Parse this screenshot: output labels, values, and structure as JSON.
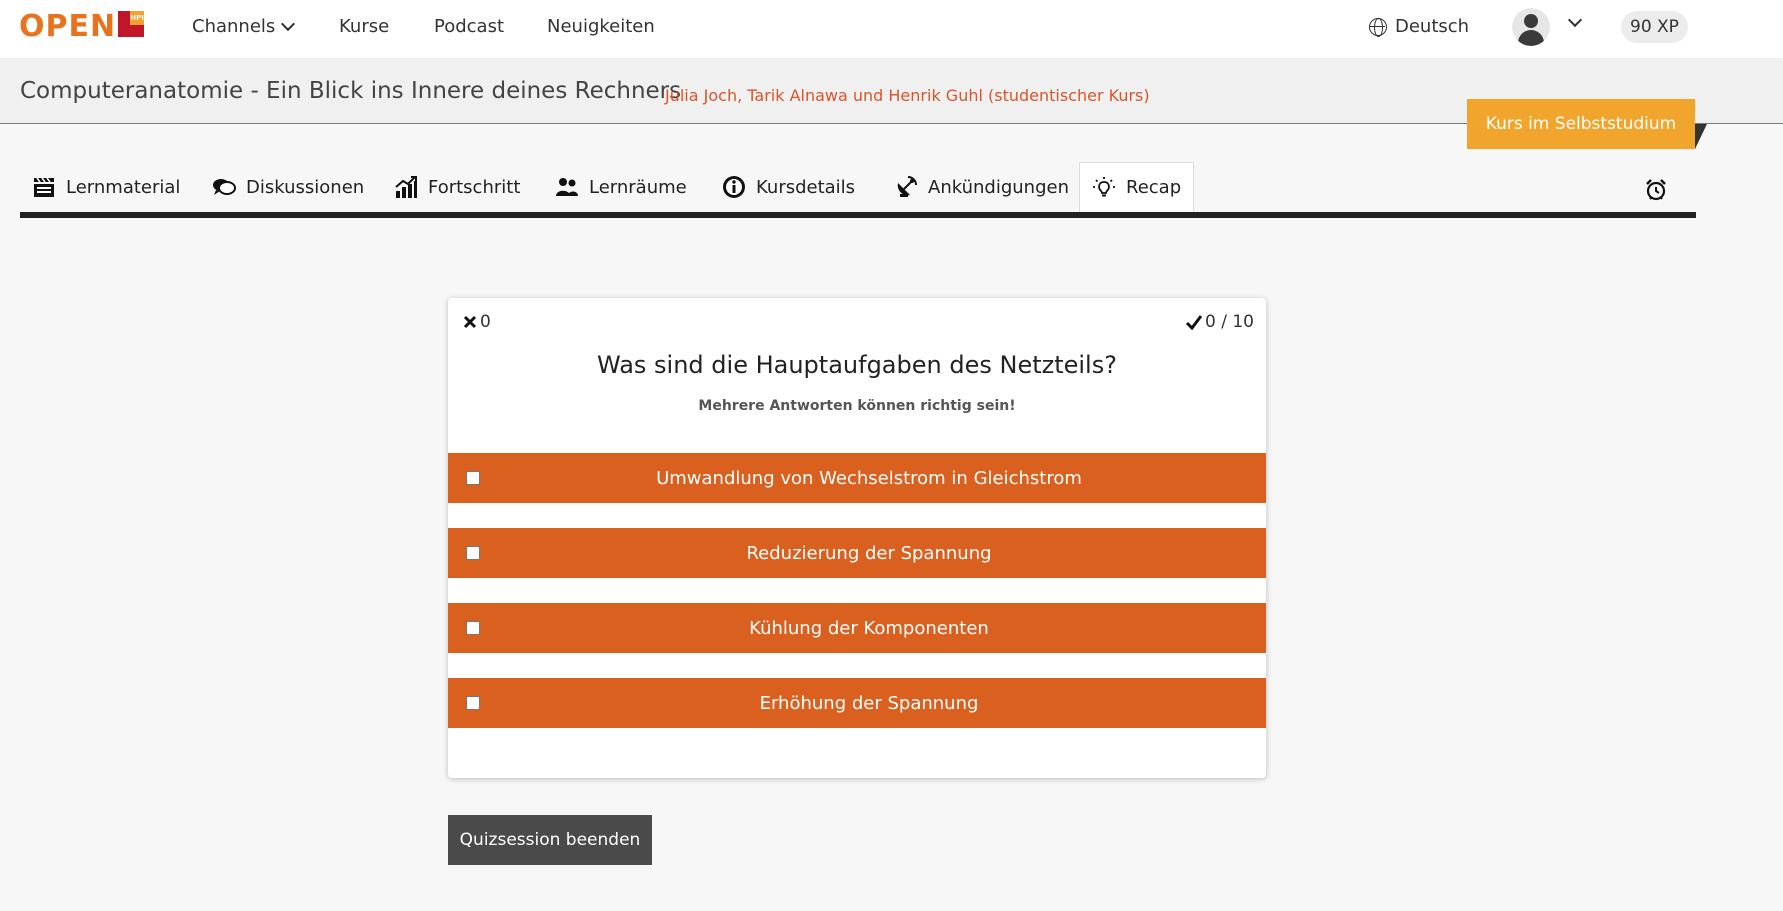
{
  "header": {
    "logo_text": "OPEN",
    "logo_badge": "HPI",
    "nav": {
      "channels": "Channels",
      "kurse": "Kurse",
      "podcast": "Podcast",
      "neuigkeiten": "Neuigkeiten"
    },
    "language": "Deutsch",
    "xp": "90 XP"
  },
  "course": {
    "title": "Computeranatomie - Ein Blick ins Innere deines Rechners",
    "authors": "Julia Joch, Tarik Alnawa und Henrik Guhl (studentischer Kurs)",
    "self_study_label": "Kurs im Selbststudium"
  },
  "tabs": [
    {
      "label": "Lernmaterial",
      "icon": "clapperboard-icon"
    },
    {
      "label": "Diskussionen",
      "icon": "speech-bubbles-icon"
    },
    {
      "label": "Fortschritt",
      "icon": "chart-icon"
    },
    {
      "label": "Lernräume",
      "icon": "people-icon"
    },
    {
      "label": "Kursdetails",
      "icon": "info-icon"
    },
    {
      "label": "Ankündigungen",
      "icon": "satellite-dish-icon"
    },
    {
      "label": "Recap",
      "icon": "lightbulb-icon",
      "active": true
    }
  ],
  "quiz": {
    "wrong_count": "0",
    "right_progress": "0 / 10",
    "question": "Was sind die Hauptaufgaben des Netzteils?",
    "hint": "Mehrere Antworten können richtig sein!",
    "answers": [
      "Umwandlung von Wechselstrom in Gleichstrom",
      "Reduzierung der Spannung",
      "Kühlung der Komponenten",
      "Erhöhung der Spannung"
    ],
    "answer_color": "#d9601f",
    "end_button": "Quizsession beenden"
  },
  "colors": {
    "brand_orange": "#e8731f",
    "brand_red": "#c0162a",
    "self_study": "#f2a52d"
  }
}
